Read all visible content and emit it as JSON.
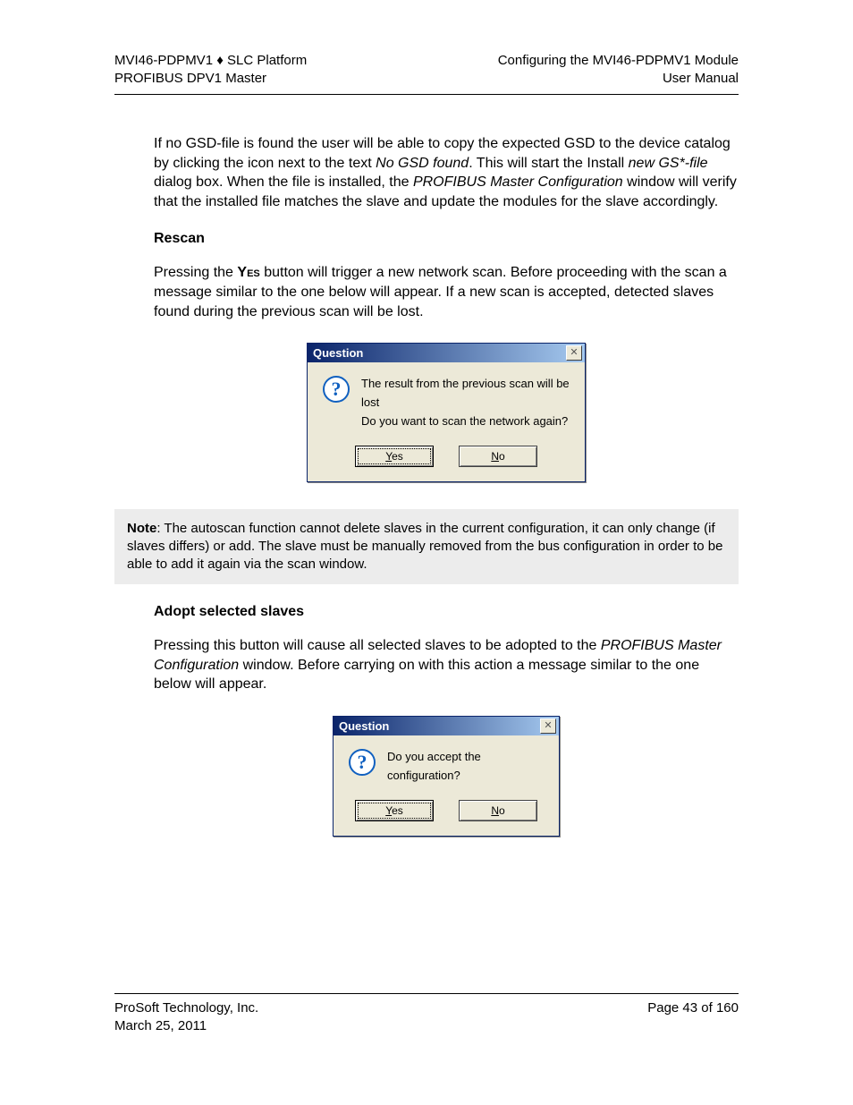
{
  "header": {
    "left_line1_a": "MVI46-PDPMV1 ",
    "left_line1_b": " SLC Platform",
    "left_line2": "PROFIBUS DPV1 Master",
    "right_line1": "Configuring the MVI46-PDPMV1 Module",
    "right_line2": "User Manual"
  },
  "para1": {
    "t1": "If no GSD-file is found the user will be able to copy the expected GSD to the device catalog by clicking the icon next to the text ",
    "i1": "No GSD found",
    "t2": ". This will start the Install ",
    "i2": "new GS*-file",
    "t3": " dialog box. When the file is installed, the ",
    "i3": "PROFIBUS Master Configuration",
    "t4": " window will verify that the installed file matches the slave and update the modules for the slave accordingly."
  },
  "rescan": {
    "heading": "Rescan",
    "t1": "Pressing the ",
    "sc": "Yes",
    "t2": " button will trigger a new network scan. Before proceeding with the scan a message similar to the one below will appear. If  a new scan is accepted, detected slaves found during the previous scan will be lost."
  },
  "dialog1": {
    "title": "Question",
    "msg": "The result from the previous scan will be lost\nDo you want to scan the network again?",
    "yes_pre": "Y",
    "yes_rest": "es",
    "no_pre": "N",
    "no_rest": "o"
  },
  "note": {
    "label": "Note",
    "text": ": The autoscan function cannot delete slaves in the current configuration, it can only change (if slaves differs) or add. The slave must be manually removed from the bus configuration in order to be able to add it again via the scan window."
  },
  "adopt": {
    "heading": "Adopt selected slaves",
    "t1": "Pressing this button will cause all selected slaves to be adopted to the ",
    "i1": "PROFIBUS Master Configuration",
    "t2": " window. Before carrying on with this action a message similar to the one below will appear."
  },
  "dialog2": {
    "title": "Question",
    "msg": "Do you accept the configuration?",
    "yes_pre": "Y",
    "yes_rest": "es",
    "no_pre": "N",
    "no_rest": "o"
  },
  "footer": {
    "company": "ProSoft Technology, Inc.",
    "date": "March 25, 2011",
    "page": "Page 43 of 160"
  }
}
